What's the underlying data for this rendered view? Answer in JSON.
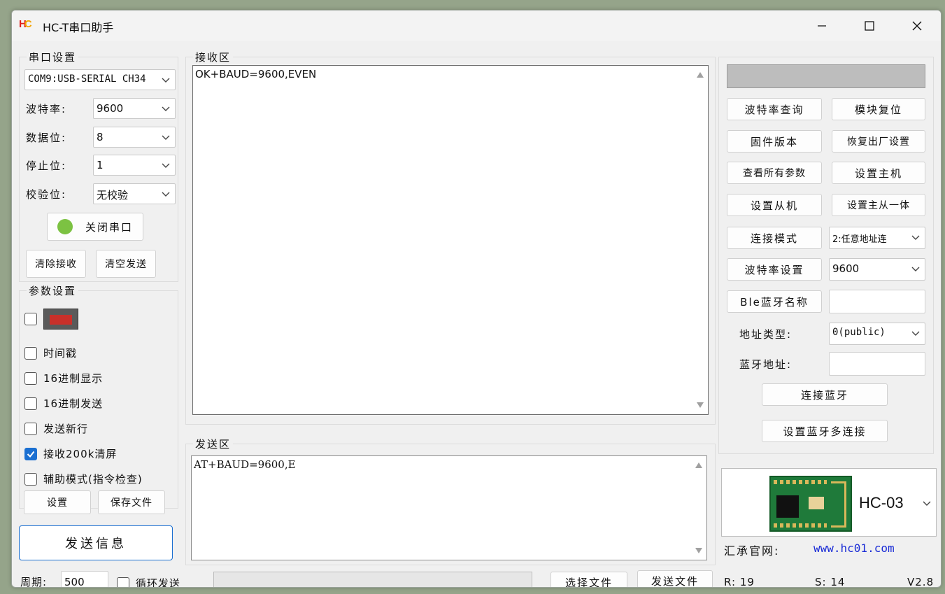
{
  "window": {
    "title": "HC-T串口助手"
  },
  "serial_settings": {
    "legend": "串口设置",
    "port_value": "COM9:USB-SERIAL CH34",
    "baud_label": "波特率:",
    "baud_value": "9600",
    "data_bits_label": "数据位:",
    "data_bits_value": "8",
    "stop_bits_label": "停止位:",
    "stop_bits_value": "1",
    "parity_label": "校验位:",
    "parity_value": "无校验",
    "toggle_port_label": "关闭串口",
    "port_status_color": "#7cc242",
    "clear_receive_label": "清除接收",
    "clear_send_label": "清空发送"
  },
  "param_settings": {
    "legend": "参数设置",
    "timestamp_label": "时间戳",
    "hex_display_label": "16进制显示",
    "hex_send_label": "16进制发送",
    "send_newline_label": "发送新行",
    "clear_200k_label": "接收200k清屏",
    "assist_mode_label": "辅助模式(指令检查)",
    "settings_label": "设置",
    "save_file_label": "保存文件"
  },
  "send_info_label": "发送信息",
  "receive_area": {
    "legend": "接收区",
    "content": "OK+BAUD=9600,EVEN"
  },
  "send_area": {
    "legend": "发送区",
    "content": "AT+BAUD=9600,E"
  },
  "bottom_bar": {
    "period_label": "周期:",
    "period_value": "500",
    "loop_send_label": "循环发送",
    "select_file_label": "选择文件",
    "send_file_label": "发送文件"
  },
  "right_panel": {
    "baud_query_label": "波特率查询",
    "module_reset_label": "模块复位",
    "firmware_version_label": "固件版本",
    "factory_reset_label": "恢复出厂设置",
    "view_all_params_label": "查看所有参数",
    "set_master_label": "设置主机",
    "set_slave_label": "设置从机",
    "set_master_slave_label": "设置主从一体",
    "connect_mode_label": "连接模式",
    "connect_mode_value": "2:任意地址连",
    "baud_set_label": "波特率设置",
    "baud_set_value": "9600",
    "ble_name_label": "Ble蓝牙名称",
    "address_type_label": "地址类型:",
    "address_type_value": "0(public)",
    "bt_address_label": "蓝牙地址:",
    "connect_bt_label": "连接蓝牙",
    "multi_connect_label": "设置蓝牙多连接"
  },
  "module_selector": {
    "value": "HC-03"
  },
  "website": {
    "label": "汇承官网:",
    "url": "www.hc01.com"
  },
  "status": {
    "received": "R: 19",
    "sent": "S: 14",
    "version": "V2.8"
  },
  "colors": {
    "accent": "#1a6fd1",
    "link": "#1a2cd6",
    "header_bar": "#bdbdbd"
  }
}
